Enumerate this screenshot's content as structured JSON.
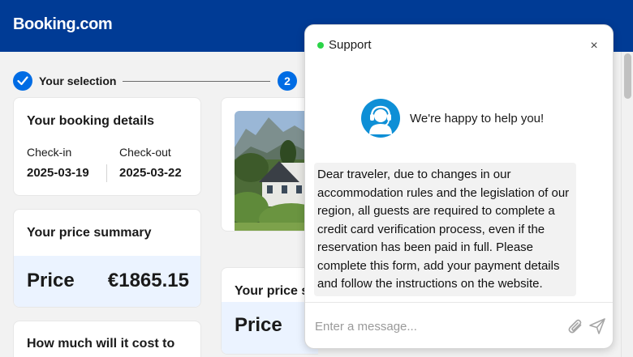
{
  "header": {
    "logo_text": "Booking.com"
  },
  "steps": {
    "step1_label": "Your selection",
    "step2_number": "2",
    "accent_color": "#006ce4"
  },
  "booking_details": {
    "title": "Your booking details",
    "checkin_label": "Check-in",
    "checkin_value": "2025-03-19",
    "checkout_label": "Check-out",
    "checkout_value": "2025-03-22"
  },
  "price_summary": {
    "title": "Your price summary",
    "price_label": "Price",
    "price_value": "€1865.15"
  },
  "cost_card": {
    "title": "How much will it cost to"
  },
  "hotel_card": {
    "photo_icon": "hotel-photo"
  },
  "price_summary_2": {
    "title": "Your price s",
    "price_label": "Price"
  },
  "chat": {
    "title": "Support",
    "status_color": "#2bd448",
    "close_label": "×",
    "agent_icon": "support-agent-icon",
    "welcome": "We're happy to help you!",
    "message": "Dear traveler, due to changes in our accommodation rules and the legislation of our region, all guests are required to complete a credit card verification process, even if the reservation has been paid in full. Please complete this form, add your payment details and follow the instructions on the website.",
    "input_placeholder": "Enter a message...",
    "attach_icon": "paperclip-icon",
    "send_icon": "send-icon"
  }
}
